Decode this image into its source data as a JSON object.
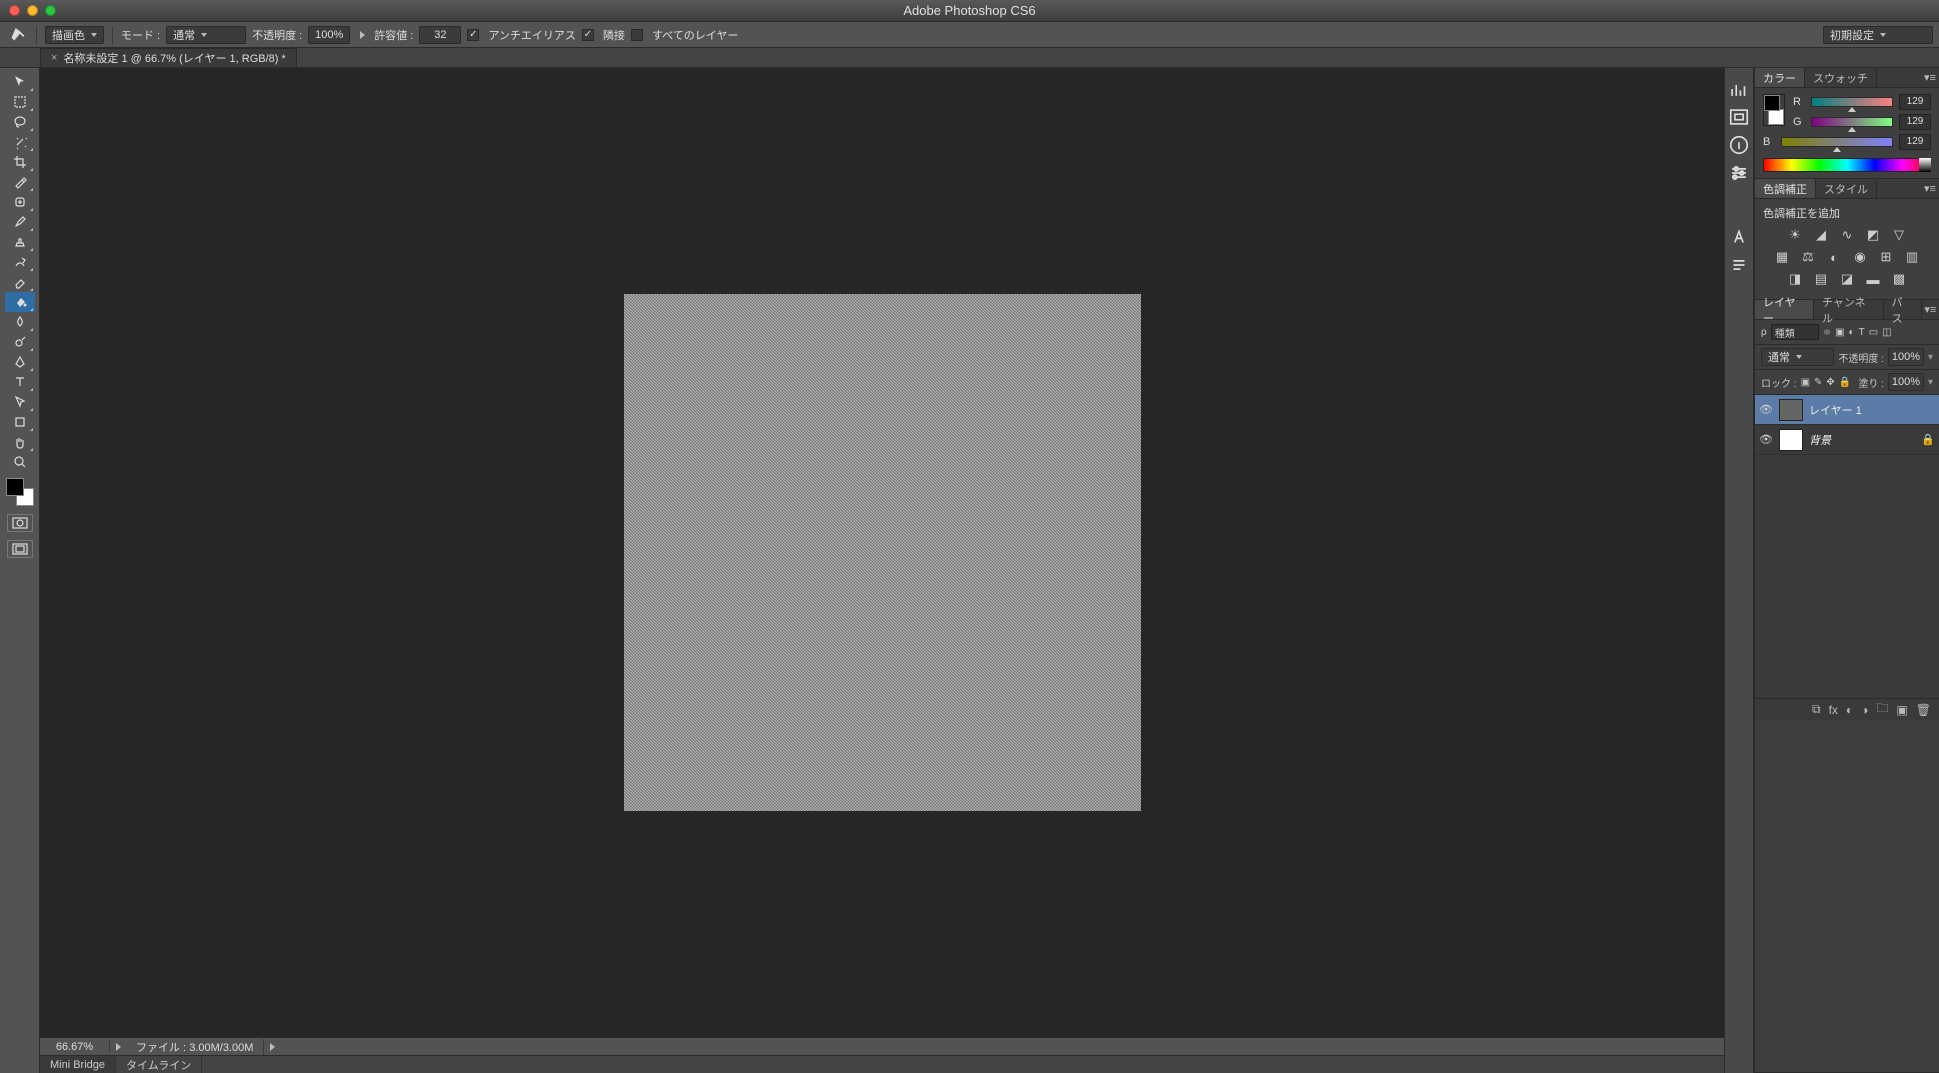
{
  "app": {
    "title": "Adobe Photoshop CS6"
  },
  "options_bar": {
    "fill_source": "描画色",
    "mode_label": "モード :",
    "mode_value": "通常",
    "opacity_label": "不透明度 :",
    "opacity_value": "100%",
    "tolerance_label": "許容値 :",
    "tolerance_value": "32",
    "antialias": "アンチエイリアス",
    "contiguous": "隣接",
    "all_layers": "すべてのレイヤー",
    "preset": "初期設定"
  },
  "document": {
    "tab_title": "名称未設定 1 @ 66.7% (レイヤー 1, RGB/8) *",
    "close_x": "×"
  },
  "status": {
    "zoom": "66.67%",
    "info_label": "ファイル :",
    "info_value": "3.00M/3.00M"
  },
  "bottom_tabs": {
    "mini_bridge": "Mini Bridge",
    "timeline": "タイムライン"
  },
  "panels": {
    "color": {
      "tab_color": "カラー",
      "tab_swatch": "スウォッチ",
      "r_label": "R",
      "r_value": "129",
      "g_label": "G",
      "g_value": "129",
      "b_label": "B",
      "b_value": "129"
    },
    "adjust": {
      "tab_adjust": "色調補正",
      "tab_style": "スタイル",
      "add_label": "色調補正を追加"
    },
    "layers": {
      "tab_layers": "レイヤー",
      "tab_channels": "チャンネル",
      "tab_paths": "パス",
      "kind_label": "種類",
      "blend_mode": "通常",
      "opacity_label": "不透明度 :",
      "opacity_value": "100%",
      "lock_label": "ロック :",
      "fill_label": "塗り :",
      "fill_value": "100%",
      "items": [
        {
          "name": "レイヤー 1",
          "locked": false
        },
        {
          "name": "背景",
          "locked": true
        }
      ]
    }
  }
}
